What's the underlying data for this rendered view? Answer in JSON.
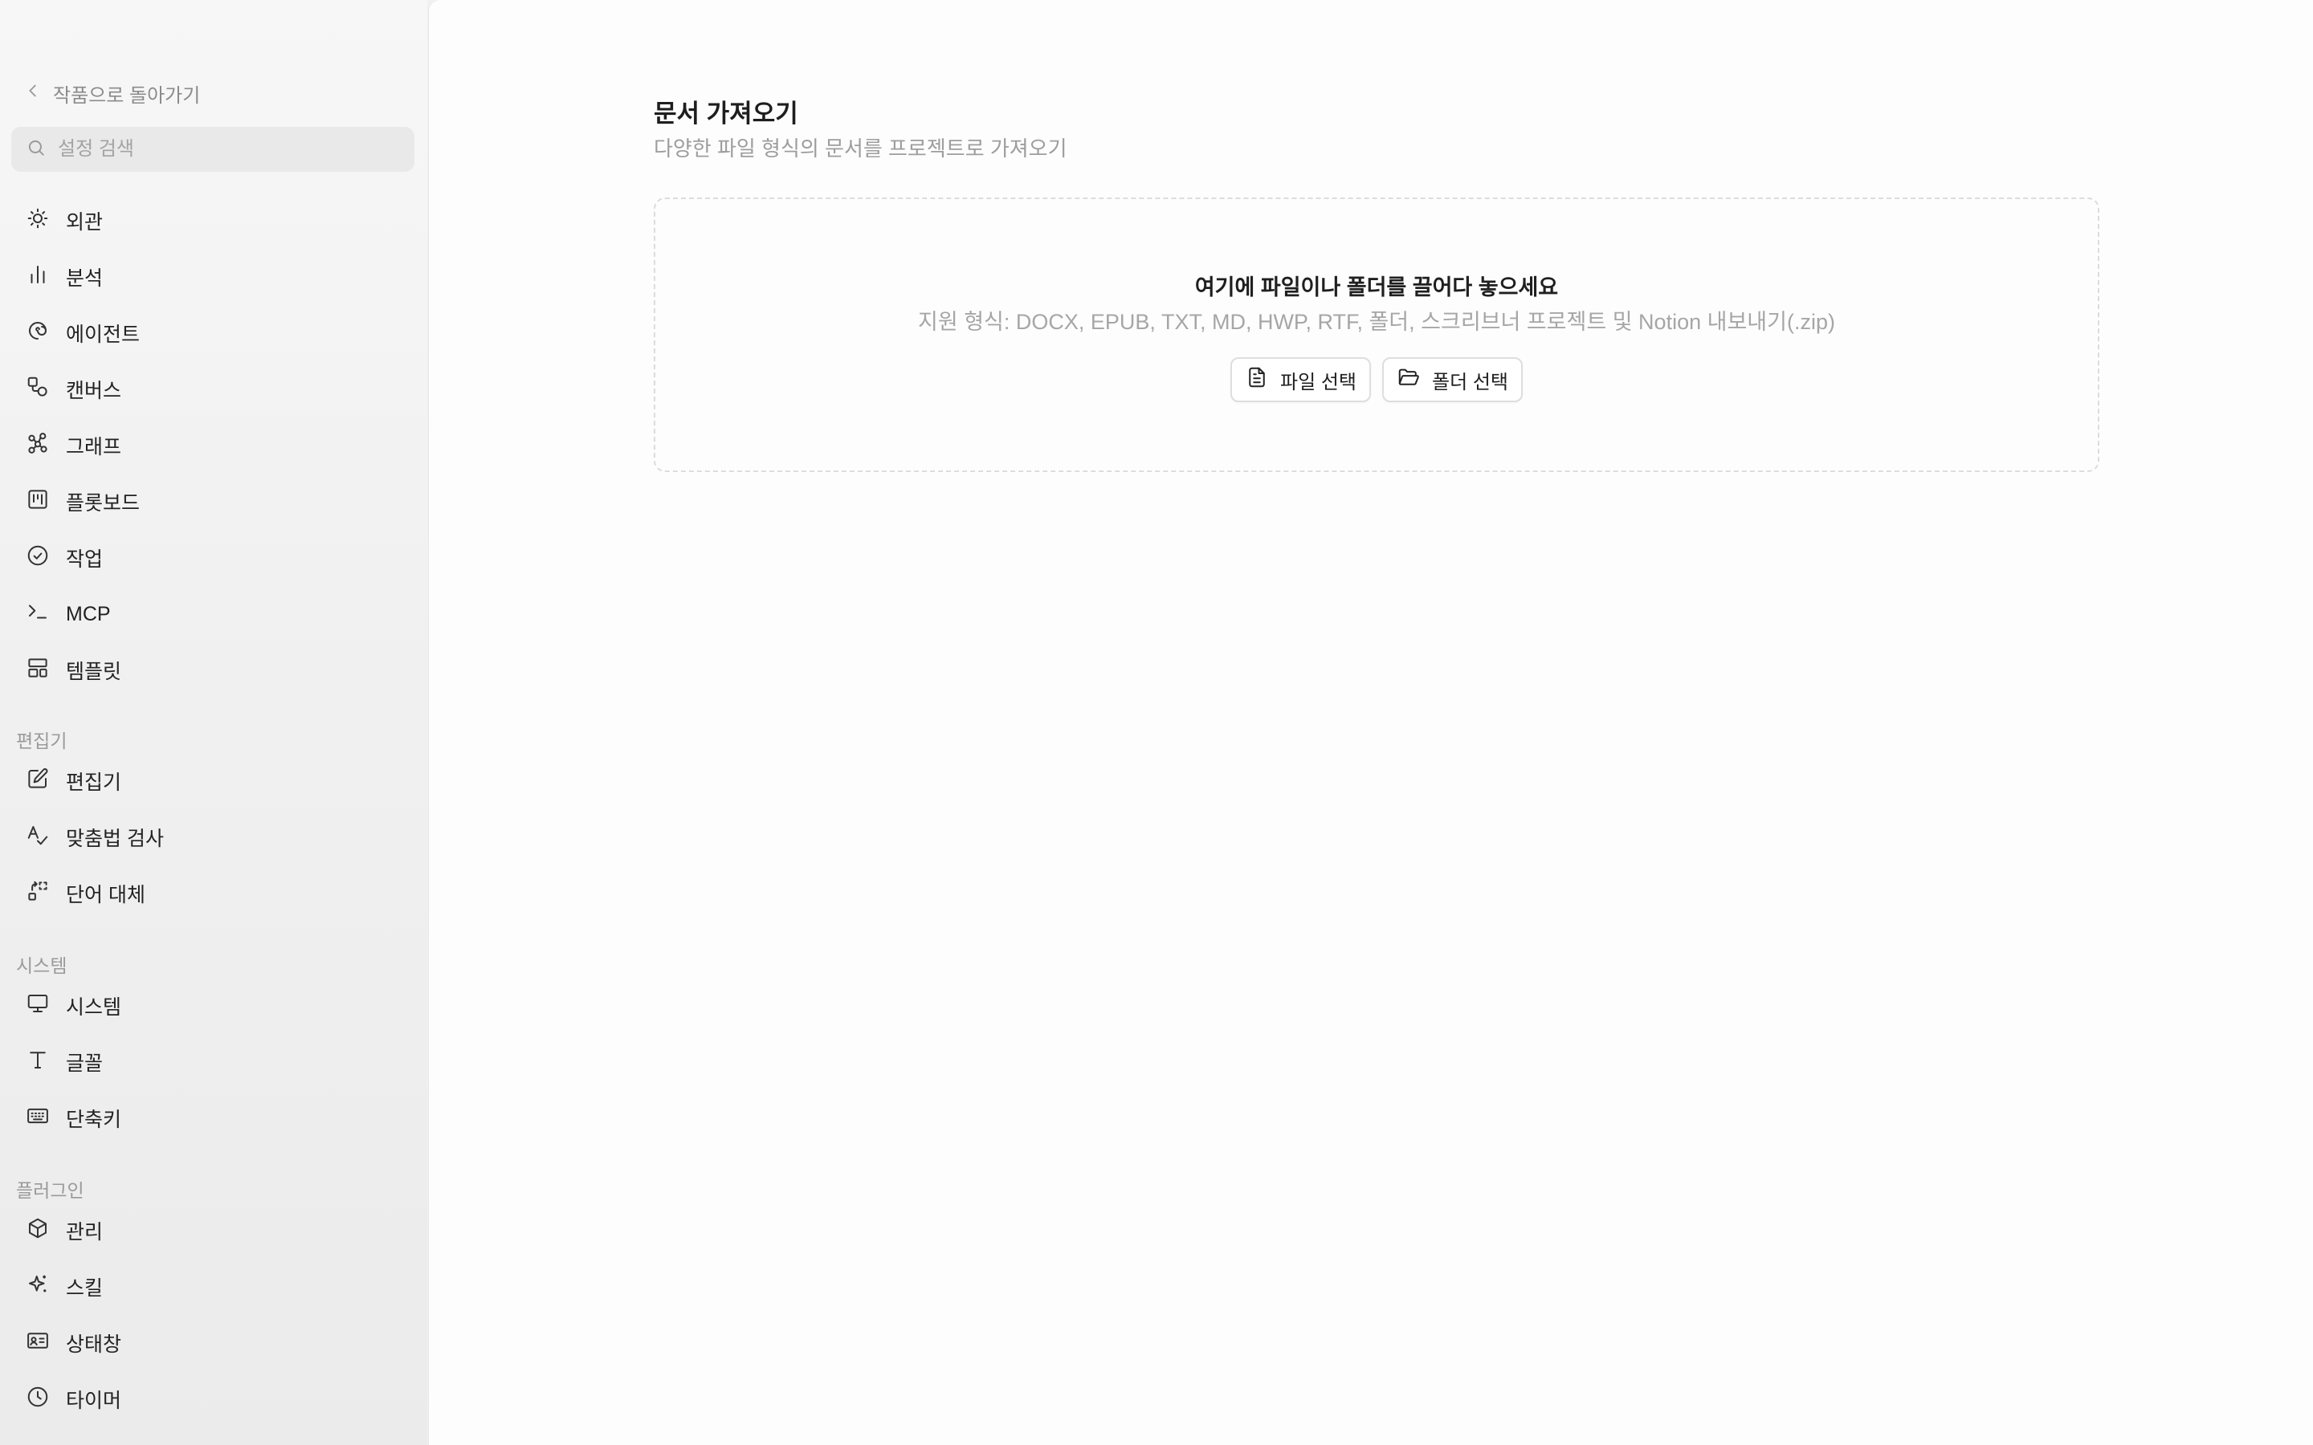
{
  "sidebar": {
    "back_label": "작품으로 돌아가기",
    "search_placeholder": "설정 검색",
    "items": [
      {
        "label": "외관",
        "icon": "sun-icon"
      },
      {
        "label": "분석",
        "icon": "bar-chart-icon"
      },
      {
        "label": "에이전트",
        "icon": "spiral-icon"
      },
      {
        "label": "캔버스",
        "icon": "shapes-icon"
      },
      {
        "label": "그래프",
        "icon": "graph-nodes-icon"
      },
      {
        "label": "플롯보드",
        "icon": "kanban-icon"
      },
      {
        "label": "작업",
        "icon": "check-circle-icon"
      },
      {
        "label": "MCP",
        "icon": "terminal-icon"
      },
      {
        "label": "템플릿",
        "icon": "layout-template-icon"
      }
    ],
    "sections": [
      {
        "label": "편집기",
        "items": [
          {
            "label": "편집기",
            "icon": "edit-square-icon"
          },
          {
            "label": "맞춤법 검사",
            "icon": "spell-check-icon"
          },
          {
            "label": "단어 대체",
            "icon": "replace-icon"
          }
        ]
      },
      {
        "label": "시스템",
        "items": [
          {
            "label": "시스템",
            "icon": "monitor-icon"
          },
          {
            "label": "글꼴",
            "icon": "type-icon"
          },
          {
            "label": "단축키",
            "icon": "keyboard-icon"
          }
        ]
      },
      {
        "label": "플러그인",
        "items": [
          {
            "label": "관리",
            "icon": "package-icon"
          },
          {
            "label": "스킬",
            "icon": "sparkles-icon"
          },
          {
            "label": "상태창",
            "icon": "id-card-icon"
          },
          {
            "label": "타이머",
            "icon": "clock-icon"
          }
        ]
      }
    ]
  },
  "main": {
    "title": "문서 가져오기",
    "subtitle": "다양한 파일 형식의 문서를 프로젝트로 가져오기",
    "dropzone": {
      "title": "여기에 파일이나 폴더를 끌어다 놓으세요",
      "formats": "지원 형식: DOCX, EPUB, TXT, MD, HWP, RTF, 폴더, 스크리브너 프로젝트 및 Notion 내보내기(.zip)",
      "select_file_label": "파일 선택",
      "select_folder_label": "폴더 선택"
    }
  }
}
